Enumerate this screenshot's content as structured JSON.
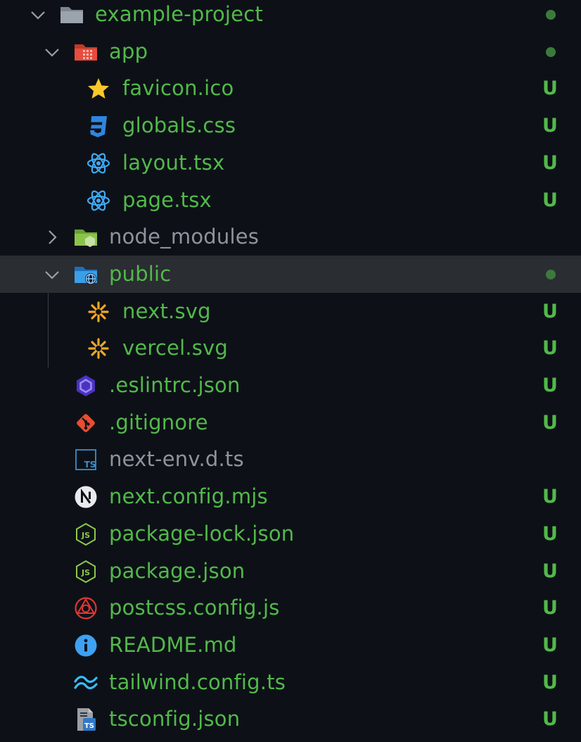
{
  "tree": [
    {
      "label": "example-project",
      "kind": "folder-root",
      "chevron": "down",
      "status": "dot"
    },
    {
      "label": "app",
      "kind": "folder-app",
      "chevron": "down",
      "status": "dot"
    },
    {
      "label": "favicon.ico",
      "kind": "favicon",
      "status": "U"
    },
    {
      "label": "globals.css",
      "kind": "css",
      "status": "U"
    },
    {
      "label": "layout.tsx",
      "kind": "react",
      "status": "U"
    },
    {
      "label": "page.tsx",
      "kind": "react",
      "status": "U"
    },
    {
      "label": "node_modules",
      "kind": "folder-node",
      "chevron": "right",
      "status": ""
    },
    {
      "label": "public",
      "kind": "folder-public",
      "chevron": "down",
      "status": "dot",
      "selected": true
    },
    {
      "label": "next.svg",
      "kind": "svg",
      "status": "U"
    },
    {
      "label": "vercel.svg",
      "kind": "svg",
      "status": "U"
    },
    {
      "label": ".eslintrc.json",
      "kind": "eslint",
      "status": "U"
    },
    {
      "label": ".gitignore",
      "kind": "git",
      "status": "U"
    },
    {
      "label": "next-env.d.ts",
      "kind": "ts",
      "status": ""
    },
    {
      "label": "next.config.mjs",
      "kind": "next",
      "status": "U"
    },
    {
      "label": "package-lock.json",
      "kind": "node-js",
      "status": "U"
    },
    {
      "label": "package.json",
      "kind": "node-js",
      "status": "U"
    },
    {
      "label": "postcss.config.js",
      "kind": "postcss",
      "status": "U"
    },
    {
      "label": "README.md",
      "kind": "info",
      "status": "U"
    },
    {
      "label": "tailwind.config.ts",
      "kind": "tailwind",
      "status": "U"
    },
    {
      "label": "tsconfig.json",
      "kind": "tsconfig",
      "status": "U"
    }
  ],
  "icon_names": {
    "folder-root": "folder-icon",
    "folder-app": "app-folder-icon",
    "favicon": "star-icon",
    "css": "css-icon",
    "react": "react-icon",
    "folder-node": "node-folder-icon",
    "folder-public": "public-folder-icon",
    "svg": "svg-icon",
    "eslint": "eslint-icon",
    "git": "git-icon",
    "ts": "typescript-icon",
    "next": "nextjs-icon",
    "node-js": "nodejs-icon",
    "postcss": "postcss-icon",
    "info": "info-icon",
    "tailwind": "tailwind-icon",
    "tsconfig": "tsconfig-icon"
  },
  "colors": {
    "modified": "#52b94a",
    "untracked_text": "#52b94a",
    "ignored_text": "#8f949c",
    "dot": "#3c7a3c",
    "selected_row": "#2a2d31",
    "background": "#0d1117"
  }
}
